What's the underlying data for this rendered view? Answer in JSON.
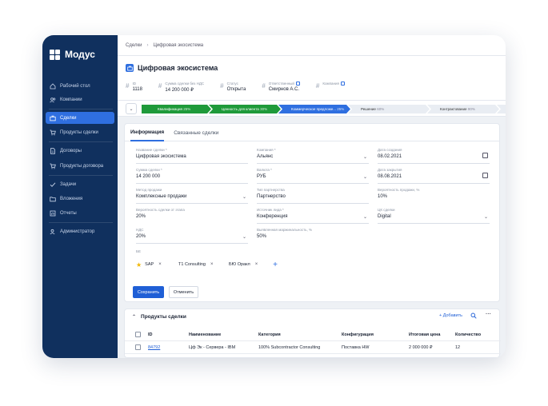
{
  "app": {
    "brand": "Модус"
  },
  "sidebar": {
    "items": [
      {
        "label": "Рабочий стол",
        "icon": "home-icon"
      },
      {
        "label": "Компании",
        "icon": "people-icon"
      },
      {
        "label": "Сделки",
        "icon": "briefcase-icon",
        "active": true
      },
      {
        "label": "Продукты сделки",
        "icon": "cart-icon"
      },
      {
        "label": "Договоры",
        "icon": "document-icon"
      },
      {
        "label": "Продукты договора",
        "icon": "cart-icon"
      },
      {
        "label": "Задачи",
        "icon": "check-icon"
      },
      {
        "label": "Вложения",
        "icon": "folder-icon"
      },
      {
        "label": "Отчеты",
        "icon": "report-icon"
      },
      {
        "label": "Администратор",
        "icon": "admin-icon"
      }
    ]
  },
  "breadcrumb": {
    "root": "Сделки",
    "current": "Цифровая экосистема"
  },
  "deal": {
    "title": "Цифровая экосистема",
    "fields": [
      {
        "label": "ID",
        "value": "1118"
      },
      {
        "label": "Сумма сделки без НДС",
        "value": "14 200 000 ₽"
      },
      {
        "label": "Статус",
        "value": "Открыта"
      },
      {
        "label": "Ответственный",
        "value": "Смирнов А.С."
      },
      {
        "label": "Компания",
        "value": ""
      }
    ]
  },
  "stages": [
    {
      "label": "Квалификация",
      "pct": "25%",
      "state": "done"
    },
    {
      "label": "Ценность для клиента",
      "pct": "30%",
      "state": "done"
    },
    {
      "label": "Коммерческое предложе...",
      "pct": "25%",
      "state": "current"
    },
    {
      "label": "Решение",
      "pct": "60%",
      "state": "todo"
    },
    {
      "label": "Контрактование",
      "pct": "90%",
      "state": "todo"
    }
  ],
  "tabs": {
    "info": "Информация",
    "related": "Связанные сделки"
  },
  "form": {
    "name": {
      "label": "Название сделки *",
      "value": "Цифровая экосистема"
    },
    "company": {
      "label": "Компания *",
      "value": "Альянс"
    },
    "created": {
      "label": "Дата создания",
      "value": "08.02.2021"
    },
    "amount": {
      "label": "Сумма сделки *",
      "value": "14 200 000"
    },
    "currency": {
      "label": "Валюта *",
      "value": "РУБ"
    },
    "closed": {
      "label": "Дата закрытия",
      "value": "08.08.2021"
    },
    "sale_method": {
      "label": "Метод продажи",
      "value": "Комплексные продажи"
    },
    "partnership": {
      "label": "Тип партнерства",
      "value": "Партнерство"
    },
    "probability": {
      "label": "Вероятность продажи, %",
      "value": "10%"
    },
    "stage_prob": {
      "label": "Вероятность сделки от этапа",
      "value": "20%"
    },
    "lead_source": {
      "label": "Источник лида *",
      "value": "Конференция"
    },
    "cc": {
      "label": "ЦК сделки",
      "value": "Digital"
    },
    "vat": {
      "label": "НДС",
      "value": "20%"
    },
    "margin": {
      "label": "Выявленная маржинальность, %",
      "value": "50%"
    },
    "bu_label": "БЕ",
    "chips": [
      "SAP",
      "T1 Consulting",
      "БЮ Оракл"
    ]
  },
  "buttons": {
    "save": "Сохранить",
    "cancel": "Отменить"
  },
  "products": {
    "title": "Продукты сделки",
    "add": "+ Добавить",
    "columns": [
      "ID",
      "Наименование",
      "Категория",
      "Конфигурация",
      "Итоговая цена",
      "Количество"
    ],
    "rows": [
      {
        "id": "84792",
        "name": "Цф Эк - Сервера - IBM",
        "category": "100% Subcontractor Consulting",
        "config": "Поставка HW",
        "price": "2 000 000 ₽",
        "qty": "12"
      }
    ]
  },
  "colors": {
    "sidebar": "#10305e",
    "accent": "#2f6fe0",
    "stage_done": "#1f9a3a",
    "stage_current": "#2f6fe0"
  }
}
